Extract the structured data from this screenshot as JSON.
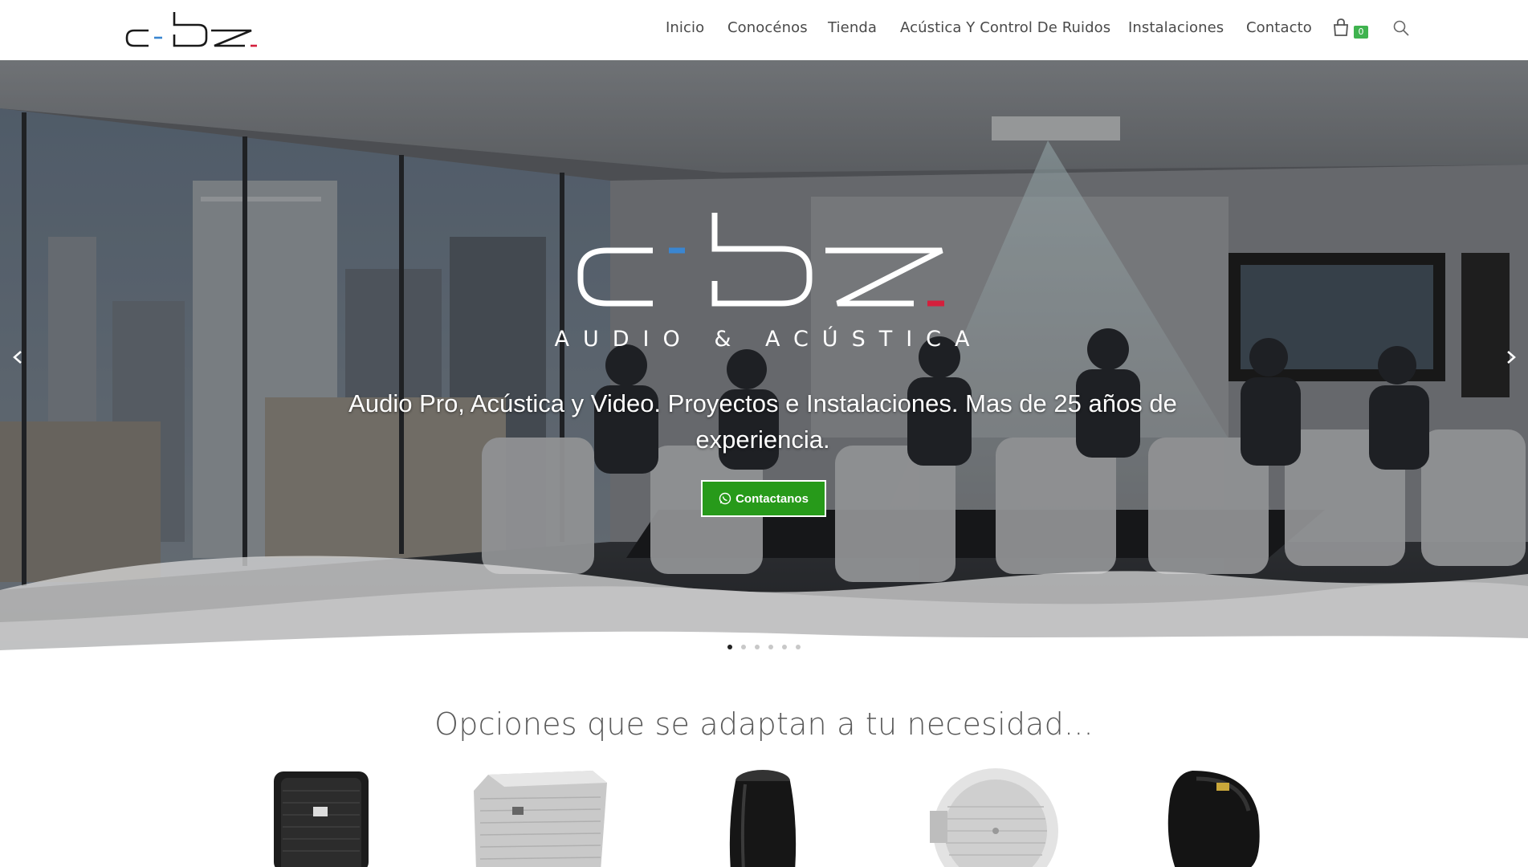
{
  "header": {
    "logo_text": "c-bz",
    "nav": [
      {
        "label": "Inicio"
      },
      {
        "label": "Conocénos"
      },
      {
        "label": "Tienda"
      },
      {
        "label": "Acústica Y Control De Ruidos"
      },
      {
        "label": "Instalaciones"
      },
      {
        "label": "Contacto"
      }
    ],
    "cart_count": "0",
    "cart_icon": "shopping-bag-icon",
    "search_icon": "search-icon"
  },
  "hero": {
    "logo_text": "c-bz",
    "tagline": "AUDIO & ACÚSTICA",
    "headline": "Audio Pro, Acústica y Video. Proyectos e Instalaciones. Mas de 25 años de experiencia.",
    "cta_label": "Contactanos",
    "cta_icon": "whatsapp-icon",
    "slide_count": 6,
    "active_slide": 1
  },
  "options": {
    "title": "Opciones que se adaptan a tu necesidad..."
  },
  "colors": {
    "accent_blue": "#3a86d1",
    "accent_red": "#d41f3c",
    "cta_green": "#279a1a",
    "badge_green": "#3fb34f"
  }
}
